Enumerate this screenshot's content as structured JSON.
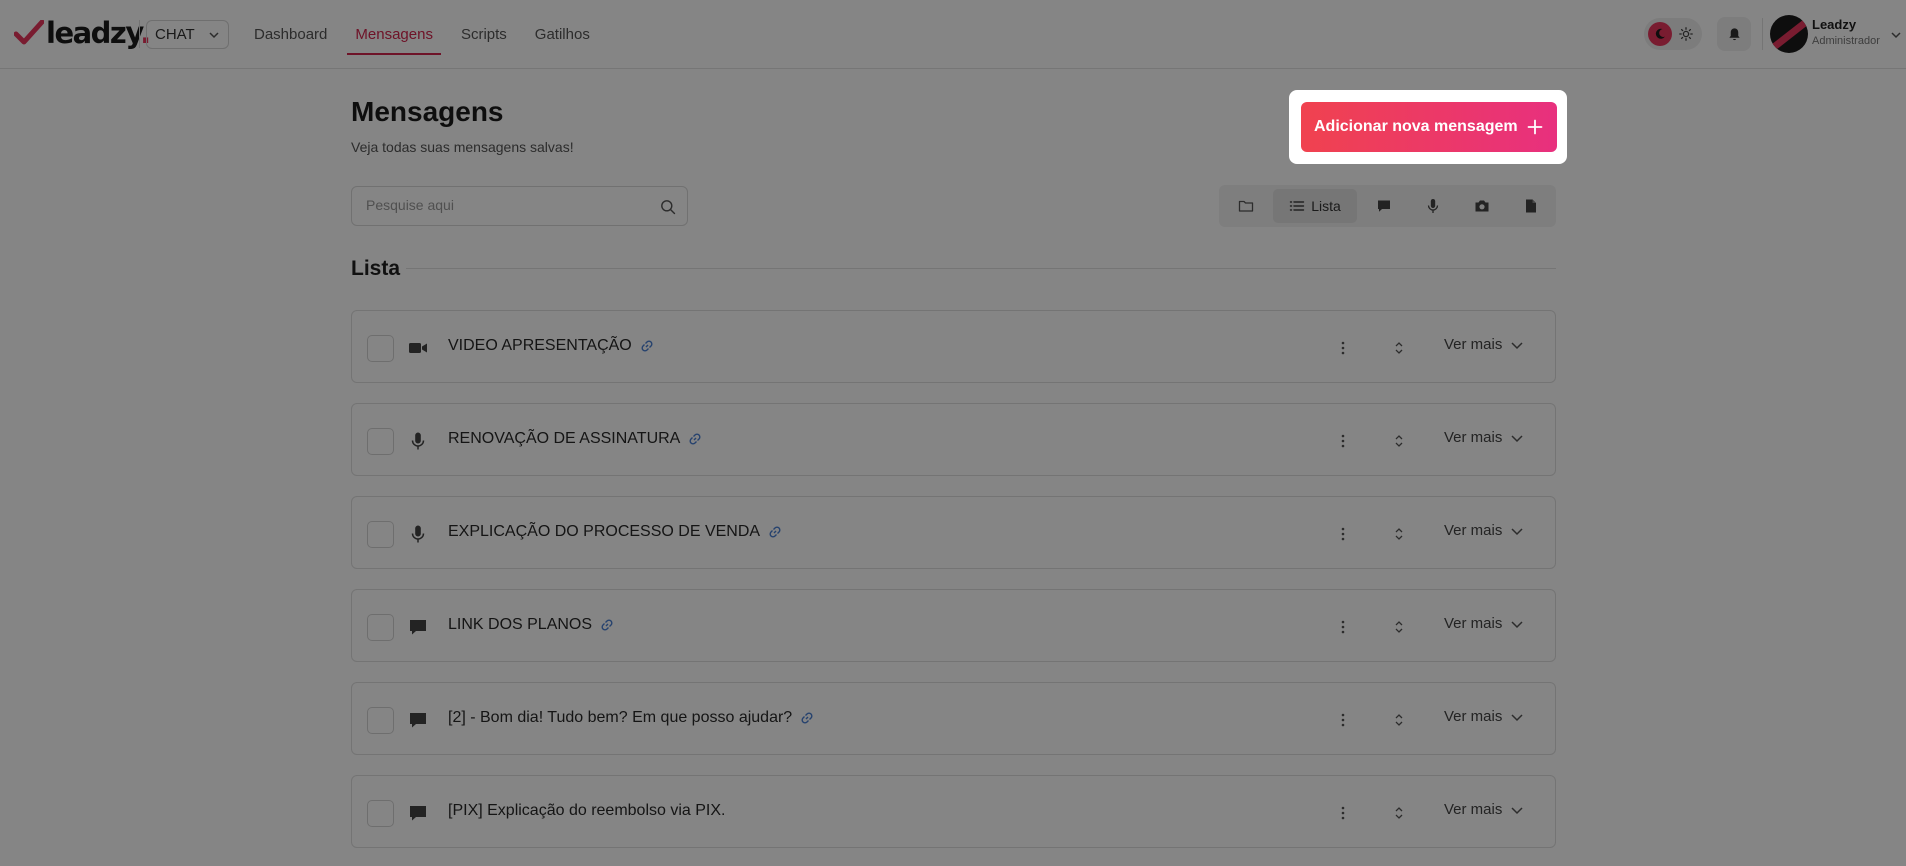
{
  "header": {
    "logo_text": "leadzy",
    "logo_dot": ".",
    "product": "CHAT",
    "nav": [
      {
        "label": "Dashboard",
        "active": false
      },
      {
        "label": "Mensagens",
        "active": true
      },
      {
        "label": "Scripts",
        "active": false
      },
      {
        "label": "Gatilhos",
        "active": false
      }
    ],
    "user": {
      "name": "Leadzy",
      "role": "Administrador"
    }
  },
  "page": {
    "title": "Mensagens",
    "subtitle": "Veja todas suas mensagens salvas!",
    "add_button": "Adicionar nova mensagem",
    "search_placeholder": "Pesquise aqui",
    "filter_active_label": "Lista",
    "section_title": "Lista"
  },
  "messages": [
    {
      "type": "video-icon",
      "title": "VIDEO APRESENTAÇÃO",
      "has_link": true,
      "more": "Ver mais"
    },
    {
      "type": "microphone-icon",
      "title": "RENOVAÇÃO DE ASSINATURA",
      "has_link": true,
      "more": "Ver mais"
    },
    {
      "type": "microphone-icon",
      "title": "EXPLICAÇÃO DO PROCESSO DE VENDA",
      "has_link": true,
      "more": "Ver mais"
    },
    {
      "type": "chat-bubble-icon",
      "title": "LINK DOS PLANOS",
      "has_link": true,
      "more": "Ver mais"
    },
    {
      "type": "chat-bubble-icon",
      "title": "[2] - Bom dia! Tudo bem? Em que posso ajudar?",
      "has_link": true,
      "more": "Ver mais"
    },
    {
      "type": "chat-bubble-icon",
      "title": "[PIX] Explicação do reembolso via PIX.",
      "has_link": false,
      "more": "Ver mais"
    }
  ],
  "colors": {
    "brand": "#e8365d",
    "nav_active": "#d4264e",
    "button_gradient_start": "#f0424f",
    "button_gradient_end": "#e8307e",
    "link_icon": "#4a7fd4"
  }
}
